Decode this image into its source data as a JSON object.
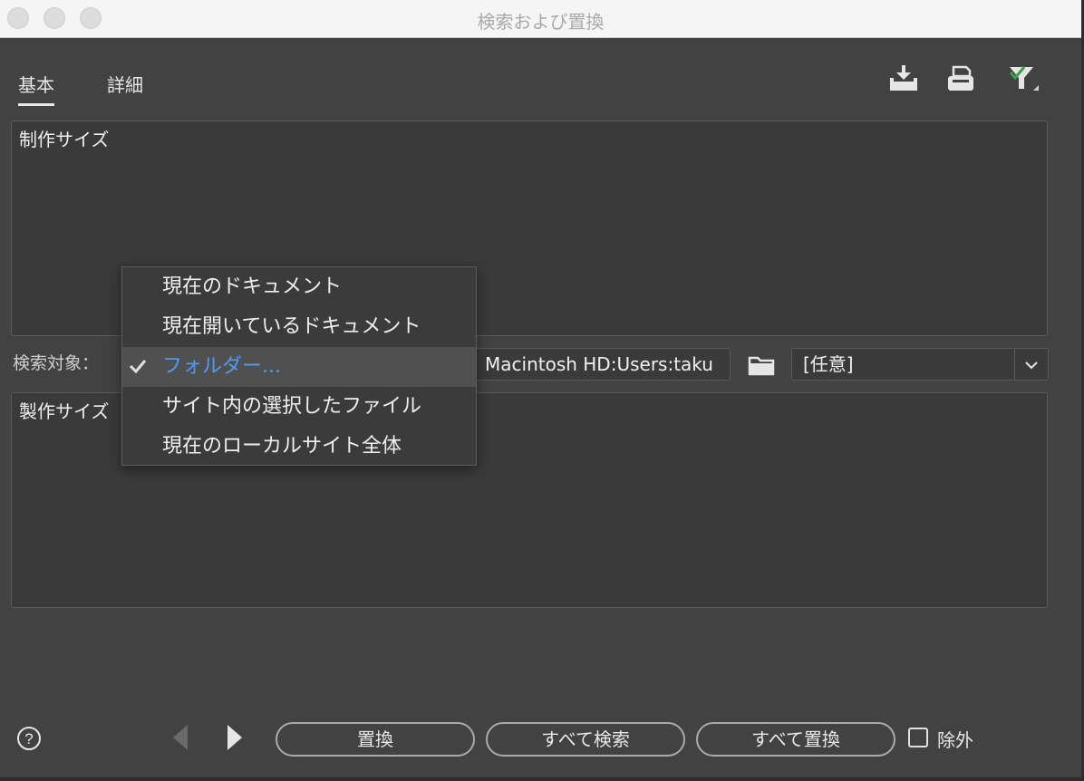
{
  "window": {
    "title": "検索および置換"
  },
  "tabs": [
    {
      "label": "基本",
      "active": true
    },
    {
      "label": "詳細",
      "active": false
    }
  ],
  "toolbar": {
    "icons": [
      "load-query-icon",
      "save-query-icon",
      "filter-icon"
    ]
  },
  "find": {
    "value": "制作サイズ"
  },
  "replace": {
    "value": "製作サイズ"
  },
  "search_in": {
    "label": "検索対象：",
    "menu": [
      {
        "label": "現在のドキュメント",
        "checked": false
      },
      {
        "label": "現在開いているドキュメント",
        "checked": false
      },
      {
        "label": "フォルダー...",
        "checked": true
      },
      {
        "label": "サイト内の選択したファイル",
        "checked": false
      },
      {
        "label": "現在のローカルサイト全体",
        "checked": false
      }
    ],
    "path": "Macintosh HD:Users:taku",
    "filter_select": "[任意]"
  },
  "footer": {
    "replace_button": "置換",
    "find_all_button": "すべて検索",
    "replace_all_button": "すべて置換",
    "exclude_label": "除外",
    "exclude_checked": false
  },
  "colors": {
    "dialog_bg": "#424242",
    "field_bg": "#3a3a3a",
    "selected_text": "#4f9bf0",
    "menu_highlight": "#505050"
  }
}
